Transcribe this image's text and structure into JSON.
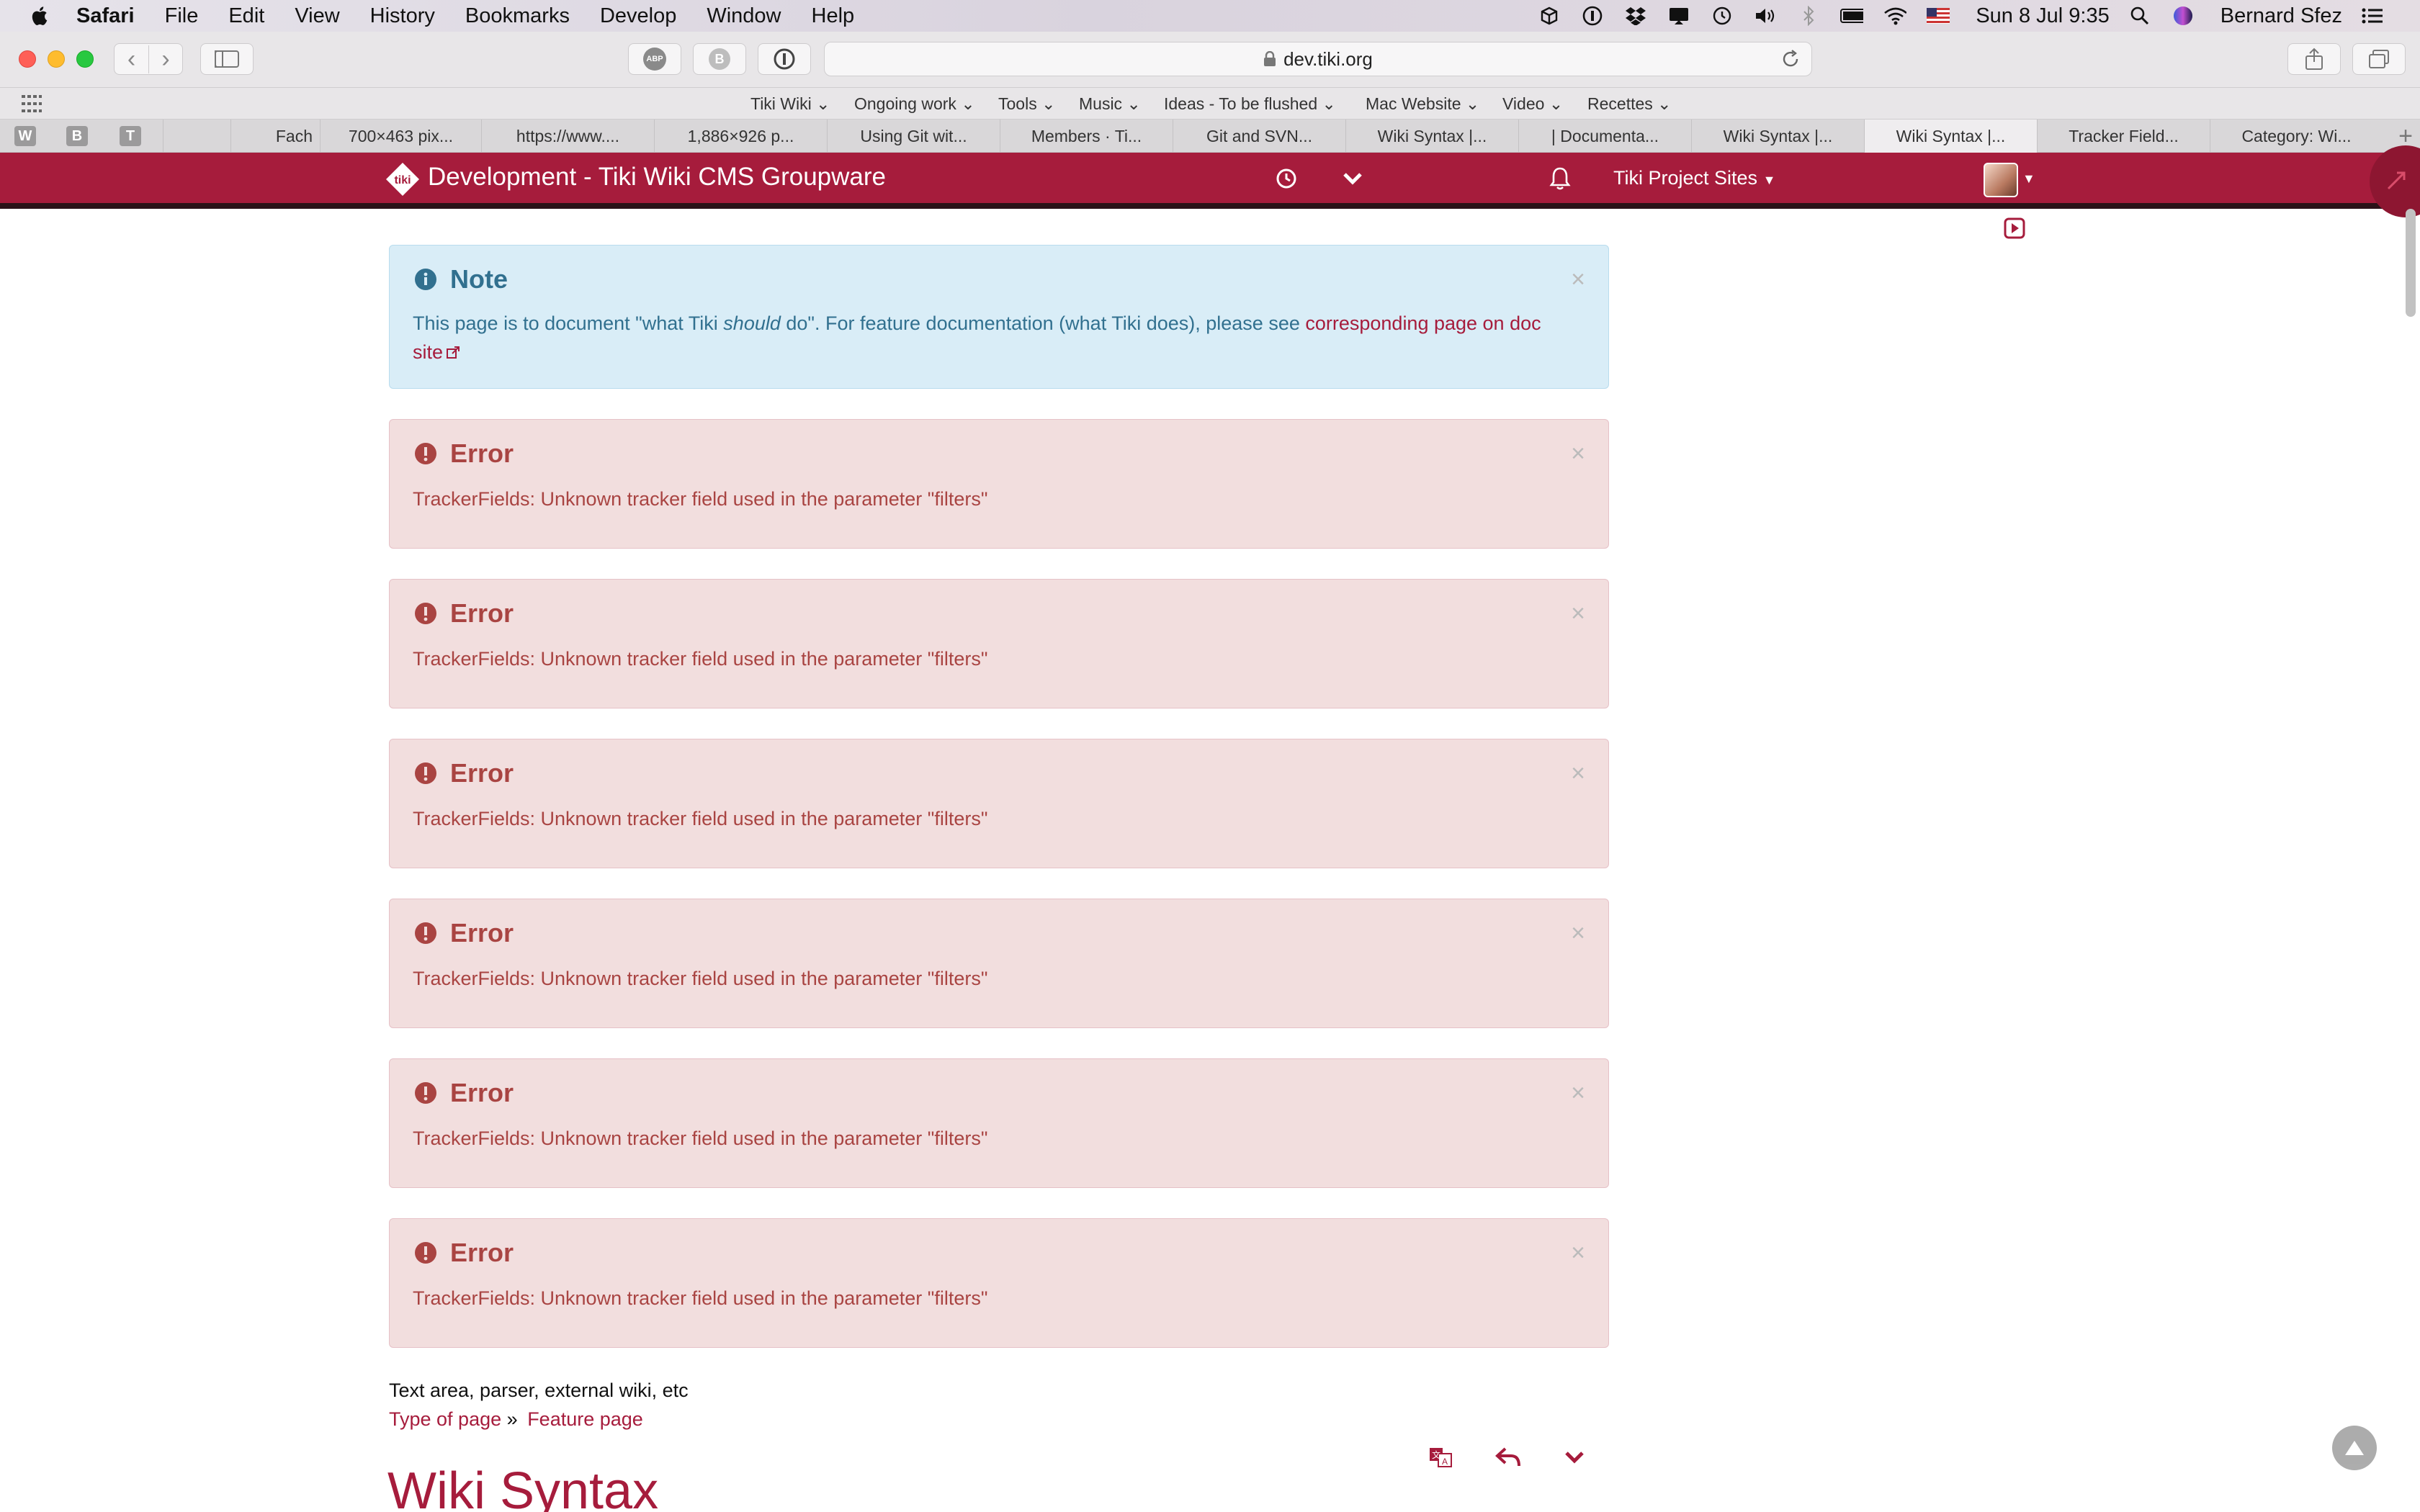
{
  "menubar": {
    "app": "Safari",
    "items": [
      "File",
      "Edit",
      "View",
      "History",
      "Bookmarks",
      "Develop",
      "Window",
      "Help"
    ],
    "clock": "Sun 8 Jul  9:35",
    "user": "Bernard Sfez",
    "status_icons": [
      "box-icon",
      "1password-icon",
      "dropbox-icon",
      "cast-icon",
      "time-machine-icon",
      "volume-icon",
      "bluetooth-icon",
      "battery-icon",
      "wifi-icon",
      "flag-us-icon",
      "spotlight-icon",
      "siri-icon",
      "list-icon"
    ]
  },
  "toolbar": {
    "url": "dev.tiki.org",
    "adblock_label": "ABP",
    "ext_b_label": "B"
  },
  "bookmarks": {
    "items": [
      "Tiki Wiki",
      "Ongoing work",
      "Tools",
      "Music",
      "Ideas - To be flushed",
      "Mac Website",
      "Video",
      "Recettes"
    ]
  },
  "tabs": {
    "pinned": [
      "W",
      "B",
      "T"
    ],
    "items": [
      "Fach",
      "700×463 pix...",
      "https://www....",
      "1,886×926 p...",
      "Using Git wit...",
      "Members · Ti...",
      "Git and SVN...",
      "Wiki Syntax |...",
      "| Documenta...",
      "Wiki Syntax |...",
      "Wiki Syntax |...",
      "Tracker Field...",
      "Category: Wi..."
    ],
    "active_index": 10
  },
  "site": {
    "title": "Development - Tiki Wiki CMS Groupware",
    "sites_menu": "Tiki Project Sites",
    "brand_color": "#a61c3c"
  },
  "note": {
    "title": "Note",
    "text_before": "This page is to document \"what Tiki ",
    "text_emph": "should",
    "text_after": " do\". For feature documentation (what Tiki does), please see ",
    "link": "corresponding page on doc site"
  },
  "errors": [
    {
      "title": "Error",
      "message": "TrackerFields: Unknown tracker field used in the parameter \"filters\""
    },
    {
      "title": "Error",
      "message": "TrackerFields: Unknown tracker field used in the parameter \"filters\""
    },
    {
      "title": "Error",
      "message": "TrackerFields: Unknown tracker field used in the parameter \"filters\""
    },
    {
      "title": "Error",
      "message": "TrackerFields: Unknown tracker field used in the parameter \"filters\""
    },
    {
      "title": "Error",
      "message": "TrackerFields: Unknown tracker field used in the parameter \"filters\""
    },
    {
      "title": "Error",
      "message": "TrackerFields: Unknown tracker field used in the parameter \"filters\""
    }
  ],
  "content": {
    "categories_text": "Text area, parser, external wiki, etc",
    "breadcrumb_type": "Type of page",
    "breadcrumb_sep": "»",
    "breadcrumb_feature": "Feature page",
    "page_heading": "Wiki Syntax"
  }
}
